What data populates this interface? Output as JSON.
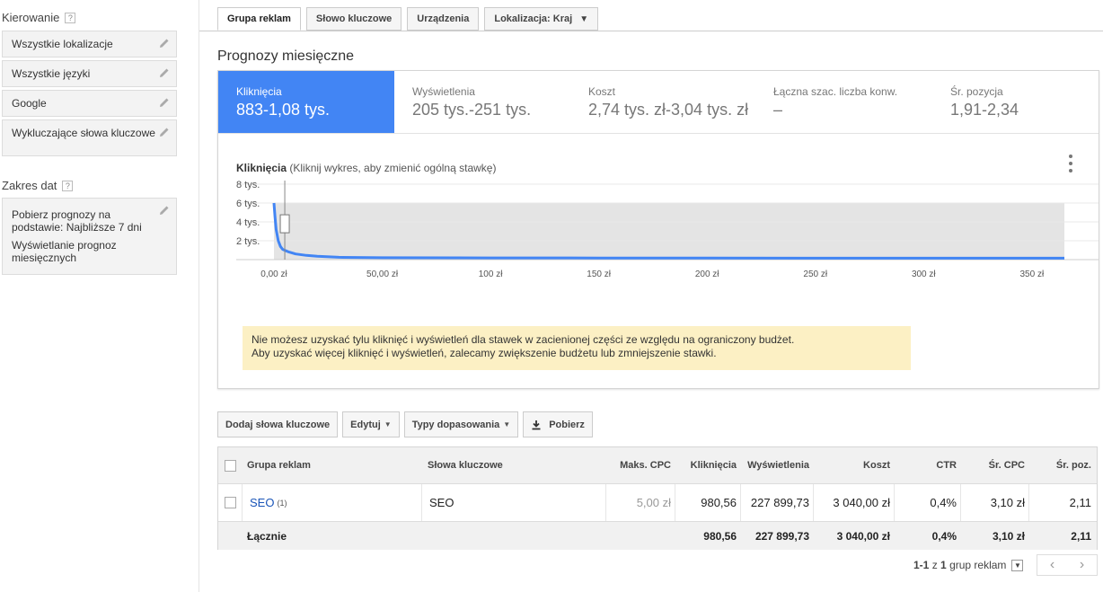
{
  "sidebar": {
    "targeting_heading": "Kierowanie",
    "targeting_items": [
      {
        "label": "Wszystkie lokalizacje"
      },
      {
        "label": "Wszystkie języki"
      },
      {
        "label": "Google"
      },
      {
        "label": "Wykluczające słowa kluczowe"
      }
    ],
    "date_heading": "Zakres dat",
    "date_line1": "Pobierz prognozy na podstawie: Najbliższe 7 dni",
    "date_line2": "Wyświetlanie prognoz miesięcznych",
    "help_glyph": "?"
  },
  "tabs": [
    {
      "label": "Grupa reklam",
      "active": true
    },
    {
      "label": "Słowo kluczowe"
    },
    {
      "label": "Urządzenia"
    },
    {
      "label": "Lokalizacja: Kraj",
      "caret": "▼"
    }
  ],
  "title": "Prognozy miesięczne",
  "metrics": [
    {
      "label": "Kliknięcia",
      "value": "883-1,08 tys.",
      "active": true
    },
    {
      "label": "Wyświetlenia",
      "value": "205 tys.-251 tys."
    },
    {
      "label": "Koszt",
      "value": "2,74 tys. zł-3,04 tys. zł"
    },
    {
      "label": "Łączna szac. liczba konw.",
      "value": "–"
    },
    {
      "label": "Śr. pozycja",
      "value": "1,91-2,34"
    }
  ],
  "chart_title_bold": "Kliknięcia",
  "chart_title_rest": "(Kliknij wykres, aby zmienić ogólną stawkę)",
  "chart_data": {
    "type": "line",
    "xlabel": "",
    "ylabel": "",
    "xlim": [
      0,
      365
    ],
    "ylim": [
      0,
      8000
    ],
    "x_ticks": [
      "0,00 zł",
      "50,00 zł",
      "100 zł",
      "150 zł",
      "200 zł",
      "250 zł",
      "300 zł",
      "350 zł"
    ],
    "y_ticks": [
      "8 tys.",
      "6 tys.",
      "4 tys.",
      "2 tys."
    ],
    "x": [
      0,
      0.5,
      1,
      2,
      3,
      4,
      5,
      7,
      10,
      15,
      20,
      30,
      50,
      100,
      150,
      200,
      250,
      300,
      350,
      365
    ],
    "y": [
      6000,
      4500,
      3200,
      2000,
      1400,
      1100,
      980,
      800,
      600,
      450,
      350,
      250,
      200,
      180,
      170,
      160,
      155,
      150,
      150,
      150
    ],
    "current_bid": 5.0,
    "current_clicks": 3800,
    "budget_shaded_max_clicks": 6000,
    "grid": true,
    "color": "#4285f4"
  },
  "warning": {
    "line1": "Nie możesz uzyskać tylu kliknięć i wyświetleń dla stawek w zacienionej części ze względu na ograniczony budżet.",
    "line2": "Aby uzyskać więcej kliknięć i wyświetleń, zalecamy zwiększenie budżetu lub zmniejszenie stawki."
  },
  "toolbar": {
    "add_keywords": "Dodaj słowa kluczowe",
    "edit": "Edytuj",
    "match_types": "Typy dopasowania",
    "download": "Pobierz"
  },
  "table": {
    "headers": [
      "Grupa reklam",
      "Słowa kluczowe",
      "Maks. CPC",
      "Kliknięcia",
      "Wyświetlenia",
      "Koszt",
      "CTR",
      "Śr. CPC",
      "Śr. poz."
    ],
    "row": {
      "group": "SEO",
      "group_count": "(1)",
      "keywords": "SEO",
      "max_cpc": "5,00 zł",
      "clicks": "980,56",
      "impressions": "227 899,73",
      "cost": "3 040,00 zł",
      "ctr": "0,4%",
      "avg_cpc": "3,10 zł",
      "avg_pos": "2,11"
    },
    "total": {
      "label": "Łącznie",
      "clicks": "980,56",
      "impressions": "227 899,73",
      "cost": "3 040,00 zł",
      "ctr": "0,4%",
      "avg_cpc": "3,10 zł",
      "avg_pos": "2,11"
    }
  },
  "pagination": {
    "range": "1-1",
    "of": "z",
    "total": "1",
    "unit": "grup reklam",
    "prev": "‹",
    "next": "›"
  }
}
